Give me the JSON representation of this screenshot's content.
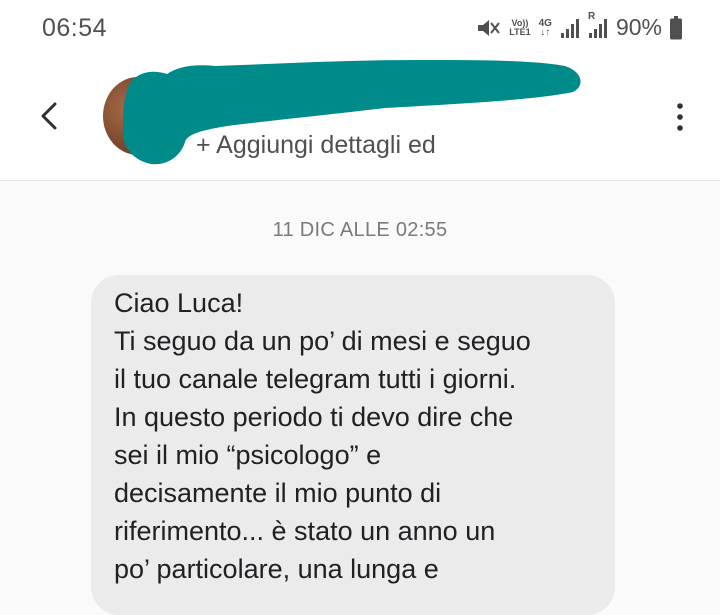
{
  "status_bar": {
    "time": "06:54",
    "volte_label_top": "Vo))",
    "volte_label_bottom": "LTE1",
    "network_label": "4G",
    "network_arrows": "↓↑",
    "roaming_label": "R",
    "battery_percent": "90%",
    "icons": [
      "vibrate-icon",
      "volte-icon",
      "network-4g-icon",
      "signal-icon",
      "signal-roaming-icon",
      "battery-icon"
    ]
  },
  "header": {
    "back_icon": "chevron-left-icon",
    "add_details_label": "+ Aggiungi dettagli ed",
    "more_icon": "more-vertical-icon"
  },
  "conversation": {
    "date_label": "11 DIC ALLE 02:55",
    "message_lines": [
      "Ciao Luca!",
      "Ti seguo da un po’ di mesi e seguo",
      "il tuo canale telegram tutti i giorni.",
      "In questo periodo ti devo dire che",
      "sei il mio “psicologo” e",
      "decisamente il mio punto di",
      "riferimento... è stato un anno un",
      "po’ particolare, una lunga e"
    ]
  },
  "colors": {
    "redaction": "#008b8b",
    "bubble": "#ebebeb",
    "background": "#fafafa"
  }
}
